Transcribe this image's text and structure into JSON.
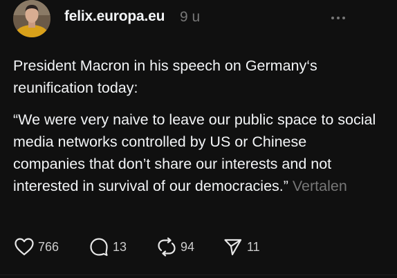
{
  "post": {
    "username": "felix.europa.eu",
    "time": "9 u",
    "paragraph1": "President Macron in his speech on Germany‘s reunification today:",
    "paragraph2": "“We were very naive to leave our public space to social media networks controlled by US or Chinese companies that don’t share our interests and not interested in survival of our democracies.”",
    "translate_label": "Vertalen"
  },
  "actions": {
    "likes": "766",
    "replies": "13",
    "reposts": "94",
    "shares": "11"
  },
  "icons": {
    "more": "more-horizontal-icon",
    "like": "heart-icon",
    "reply": "comment-bubble-icon",
    "repost": "repost-icon",
    "share": "send-icon"
  },
  "colors": {
    "background": "#101010",
    "text": "#f3f5f7",
    "muted": "#777777"
  }
}
